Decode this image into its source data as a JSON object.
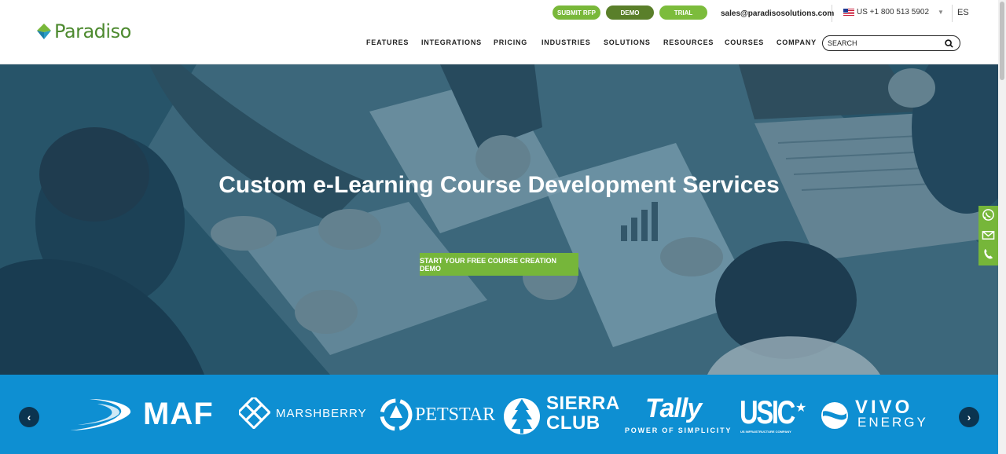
{
  "header": {
    "logo_text": "Paradiso",
    "buttons": {
      "rfp": "SUBMIT RFP",
      "demo": "DEMO",
      "trial": "TRIAL"
    },
    "email": "sales@paradisosolutions.com",
    "phone": "US +1 800 513 5902",
    "language": "ES",
    "nav": [
      "FEATURES",
      "INTEGRATIONS",
      "PRICING",
      "INDUSTRIES",
      "SOLUTIONS",
      "RESOURCES",
      "COURSES",
      "COMPANY"
    ],
    "search_placeholder": "SEARCH"
  },
  "hero": {
    "title": "Custom e-Learning Course Development Services",
    "cta": "START YOUR FREE COURSE CREATION DEMO"
  },
  "clients": {
    "maf": "MAF",
    "marshberry": "MARSHBERRY",
    "petstar": "PETSTAR",
    "sierra_1": "SIERRA",
    "sierra_2": "CLUB",
    "tally": "Tally",
    "tally_tagline": "POWER OF SIMPLICITY",
    "usic": "USIC",
    "usic_tagline": "US INFRASTRUCTURE COMPANY",
    "vivo_1": "VIVO",
    "vivo_2": "ENERGY"
  },
  "colors": {
    "brand_green": "#76b63a",
    "dark_green": "#5a7f2a",
    "strip_blue": "#0e8fd2",
    "arrow_navy": "#0b3450"
  },
  "icons": [
    "search-icon",
    "us-flag-icon",
    "whatsapp-icon",
    "mail-icon",
    "phone-icon",
    "chevron-left-icon",
    "chevron-right-icon"
  ]
}
